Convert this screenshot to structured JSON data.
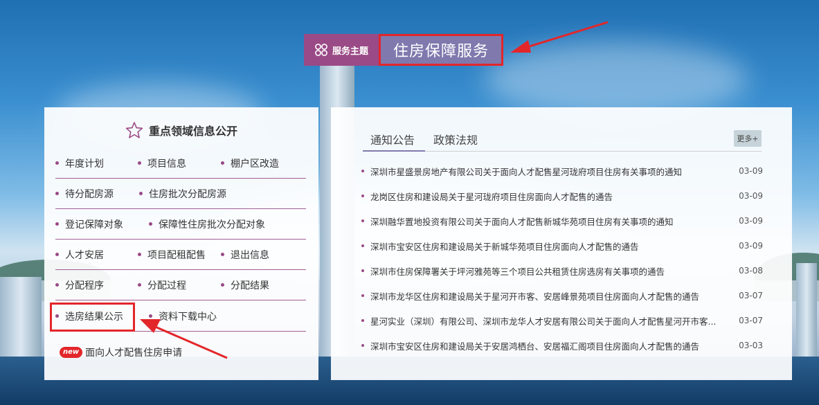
{
  "theme": {
    "tag_label": "服务主题",
    "title": "住房保障服务"
  },
  "left_panel": {
    "heading": "重点领域信息公开",
    "rows": [
      [
        "年度计划",
        "项目信息",
        "棚户区改造"
      ],
      [
        "待分配房源",
        "住房批次分配房源"
      ],
      [
        "登记保障对象",
        "保障性住房批次分配对象"
      ],
      [
        "人才安居",
        "项目配租配售",
        "退出信息"
      ],
      [
        "分配程序",
        "分配过程",
        "分配结果"
      ],
      [
        "选房结果公示",
        "资料下载中心"
      ]
    ],
    "new_badge": "new",
    "apply_label": "面向人才配售住房申请"
  },
  "right_panel": {
    "tabs": [
      "通知公告",
      "政策法规"
    ],
    "more_label": "更多+",
    "news": [
      {
        "title": "深圳市星盛景房地产有限公司关于面向人才配售星河珑府项目住房有关事项的通知",
        "date": "03-09"
      },
      {
        "title": "龙岗区住房和建设局关于星河珑府项目住房面向人才配售的通告",
        "date": "03-09"
      },
      {
        "title": "深圳融华置地投资有限公司关于面向人才配售新城华苑项目住房有关事项的通知",
        "date": "03-09"
      },
      {
        "title": "深圳市宝安区住房和建设局关于新城华苑项目住房面向人才配售的通告",
        "date": "03-09"
      },
      {
        "title": "深圳市住房保障署关于坪河雅苑等三个项目公共租赁住房选房有关事项的通告",
        "date": "03-08"
      },
      {
        "title": "深圳市龙华区住房和建设局关于星河开市客、安居峰景苑项目住房面向人才配售的通告",
        "date": "03-07"
      },
      {
        "title": "星河实业（深圳）有限公司、深圳市龙华人才安居有限公司关于面向人才配售星河开市客...",
        "date": "03-07"
      },
      {
        "title": "深圳市宝安区住房和建设局关于安居鸿栖台、安居福汇阁项目住房面向人才配售的通告",
        "date": "03-03"
      }
    ]
  },
  "colors": {
    "accent_purple": "#9a4a86",
    "title_bg": "#8079ae",
    "annotation_red": "#e3262a"
  }
}
